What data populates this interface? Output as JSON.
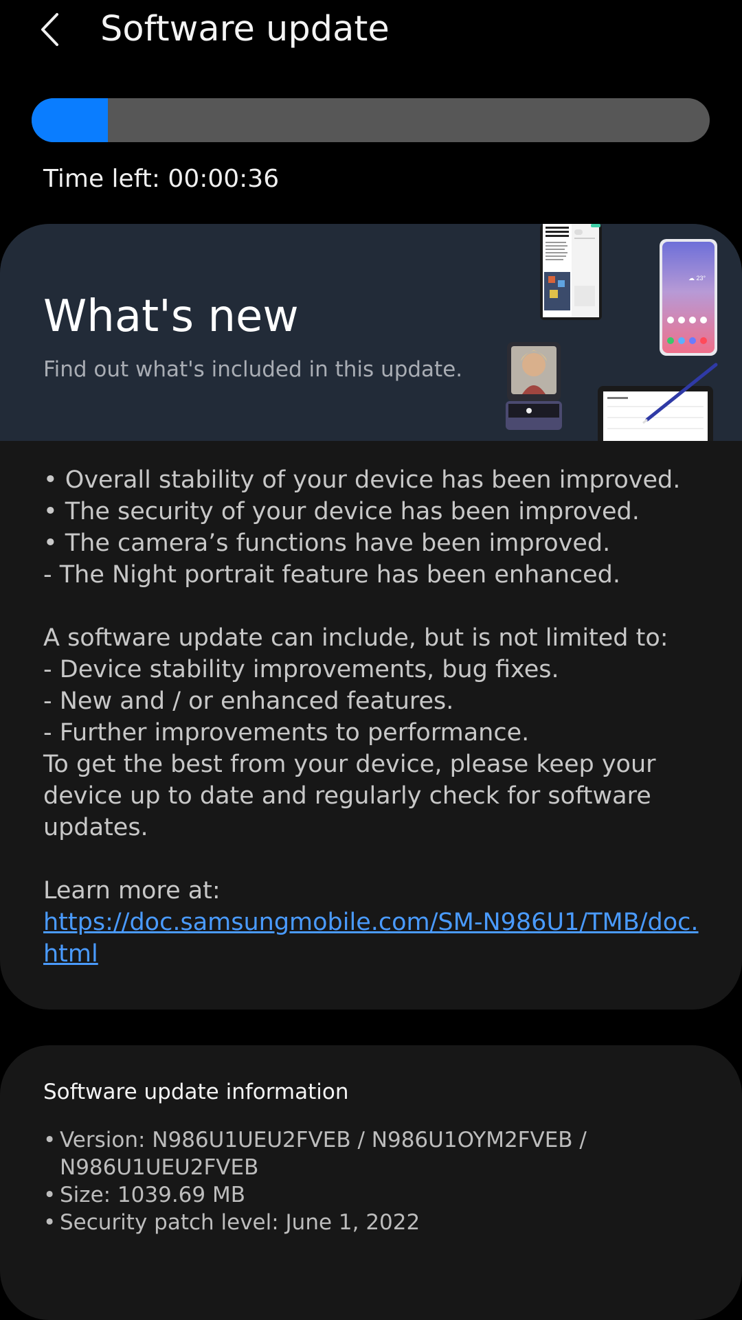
{
  "header": {
    "back_icon": "chevron-left-icon",
    "title": "Software update"
  },
  "progress": {
    "fraction": 0.112,
    "track_color": "#575757",
    "fill_color": "#0a7dff",
    "time_left": "Time left: 00:00:36"
  },
  "whats_new": {
    "title": "What's new",
    "subtitle": "Find out what's included in this update.",
    "banner_color": "#222b38"
  },
  "notes": {
    "bullets": [
      "• Overall stability of your device has been improved.",
      "• The security of your device has been improved.",
      "• The camera’s functions have been improved.",
      " - The Night portrait feature has been enhanced."
    ],
    "intro": "A software update can include, but is not limited to:",
    "items": [
      " - Device stability improvements, bug fixes.",
      " - New and / or enhanced features.",
      " - Further improvements to performance."
    ],
    "advice": "To get the best from your device, please keep your device up to date and regularly check for software updates.",
    "learn_more": "Learn more at:",
    "link": "https://doc.samsungmobile.com/SM-N986U1/TMB/doc.html",
    "link_color": "#4a9bff"
  },
  "info": {
    "title": "Software update information",
    "items": [
      "Version: N986U1UEU2FVEB / N986U1OYM2FVEB / N986U1UEU2FVEB",
      "Size: 1039.69 MB",
      "Security patch level: June 1, 2022"
    ]
  }
}
